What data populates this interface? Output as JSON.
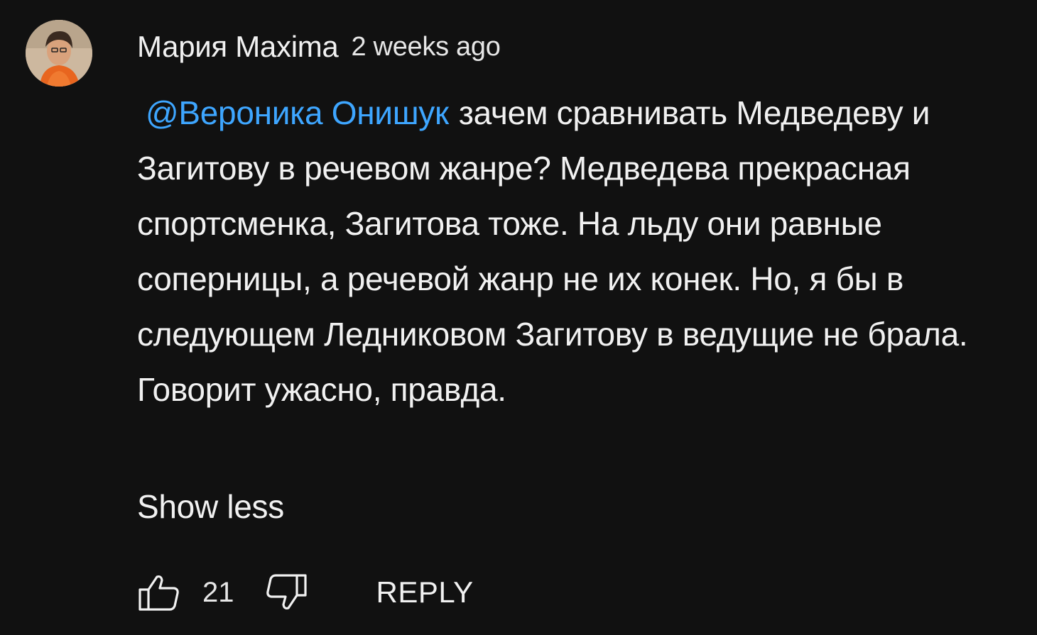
{
  "comment": {
    "author": "Мария Maxima",
    "timestamp": "2 weeks ago",
    "avatar_icon": "user-avatar-photo",
    "mention": "@Вероника Онишук",
    "text": "зачем сравнивать Медведеву и Загитову в речевом жанре? Медведева прекрасная спортсменка, Загитова тоже. На льду они равные соперницы, а речевой жанр не их конек. Но, я бы в следующем Ледниковом Загитову в ведущие не брала. Говорит ужасно, правда.",
    "show_less_label": "Show less",
    "like_count": "21",
    "reply_label": "REPLY"
  },
  "colors": {
    "background": "#111111",
    "text": "#f1f1f1",
    "mention": "#3ea6ff"
  },
  "icons": {
    "like": "thumbs-up-icon",
    "dislike": "thumbs-down-icon"
  }
}
